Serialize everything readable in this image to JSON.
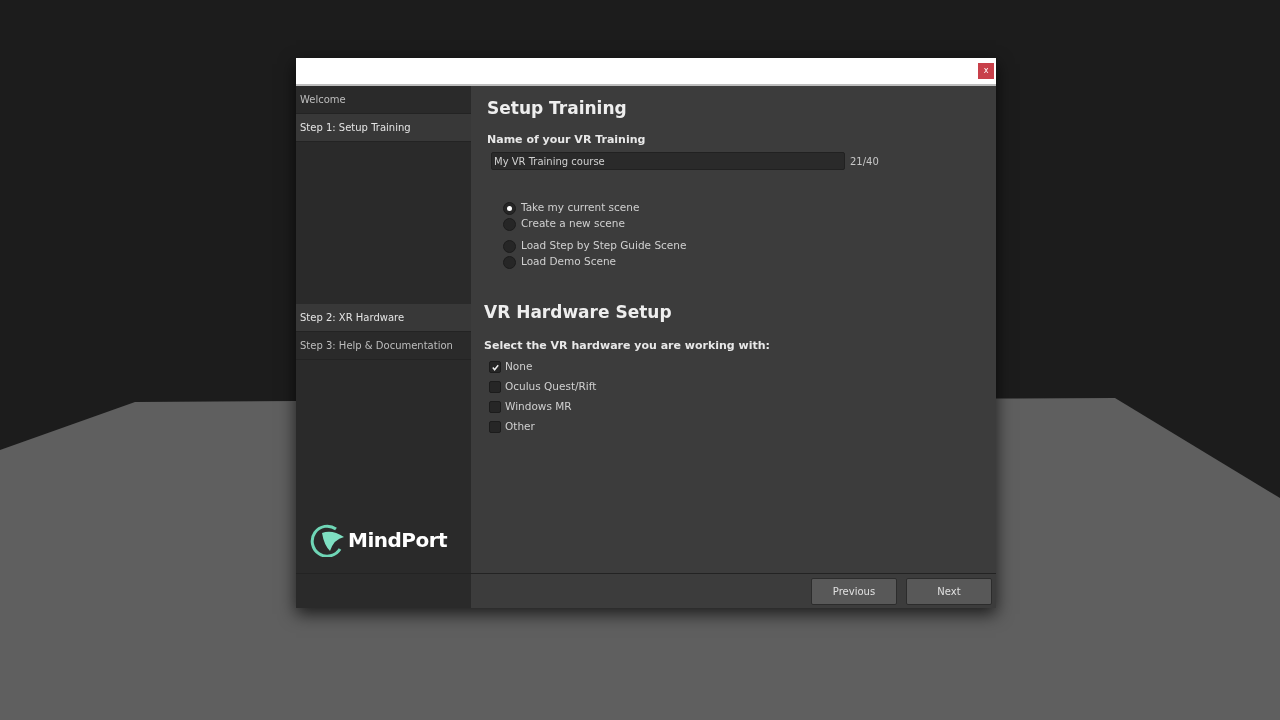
{
  "window": {
    "close": "x"
  },
  "sidebar": {
    "items": [
      {
        "label": "Welcome",
        "selected": false
      },
      {
        "label": "Step 1: Setup Training",
        "selected": true
      },
      {
        "label": "Step 2: XR Hardware",
        "selected": true
      },
      {
        "label": "Step 3: Help & Documentation",
        "selected": false
      }
    ],
    "logo": "MindPort"
  },
  "setup": {
    "title": "Setup Training",
    "name_label": "Name of your VR Training",
    "name_value": "My VR Training course",
    "counter": "21/40",
    "scene_groups": [
      [
        {
          "label": "Take my current scene",
          "selected": true
        },
        {
          "label": "Create a new scene",
          "selected": false
        }
      ],
      [
        {
          "label": "Load Step by Step Guide Scene",
          "selected": false
        },
        {
          "label": "Load Demo Scene",
          "selected": false
        }
      ]
    ]
  },
  "hardware": {
    "title": "VR Hardware Setup",
    "prompt": "Select the VR hardware you are working with:",
    "options": [
      {
        "label": "None",
        "checked": true
      },
      {
        "label": "Oculus Quest/Rift",
        "checked": false
      },
      {
        "label": "Windows MR",
        "checked": false
      },
      {
        "label": "Other",
        "checked": false
      }
    ]
  },
  "buttons": [
    "Previous",
    "Next"
  ]
}
